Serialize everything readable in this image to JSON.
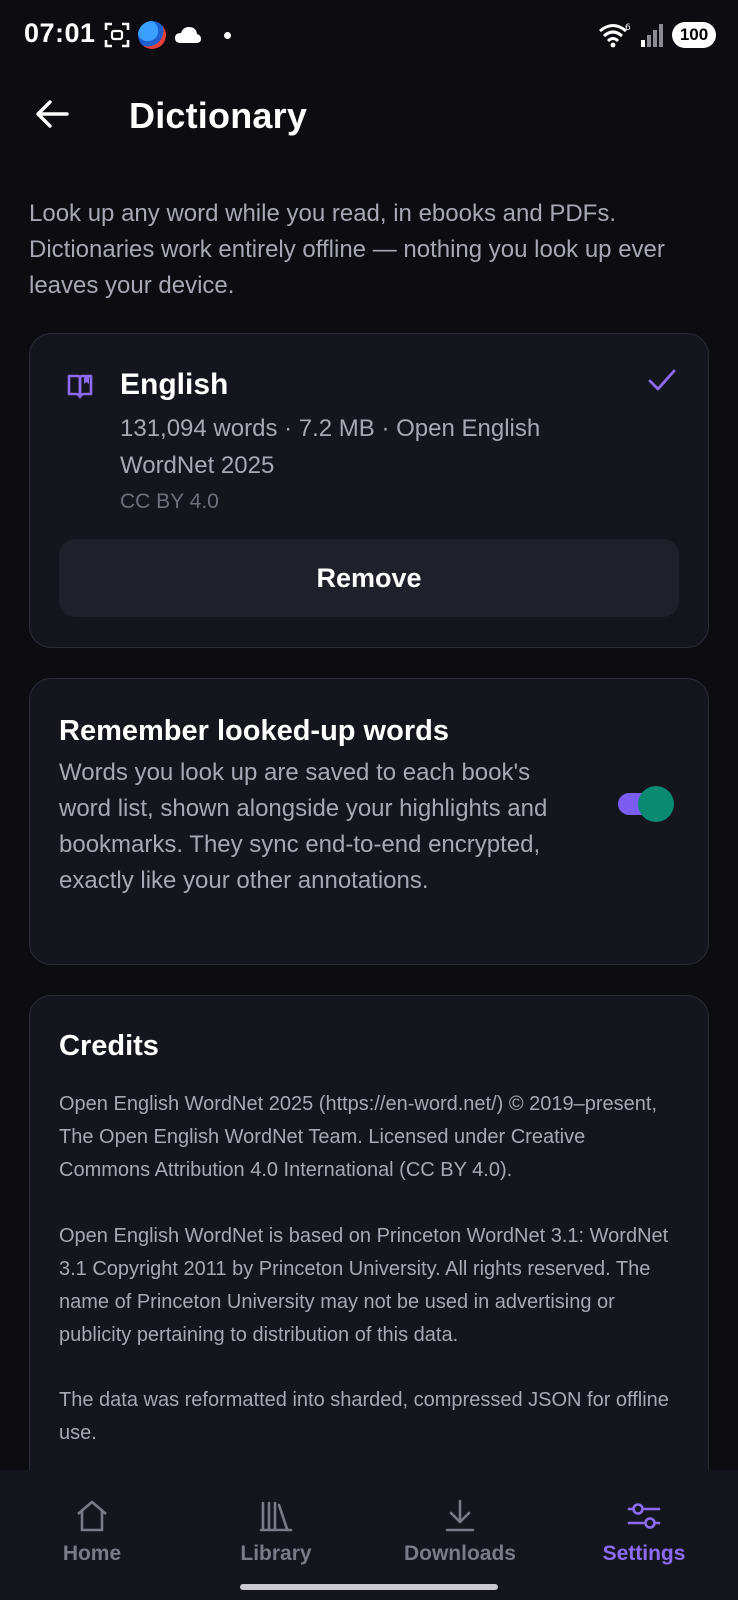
{
  "status_bar": {
    "time": "07:01",
    "battery": "100",
    "icons": [
      "screenshot-icon",
      "app-icon",
      "cloud-icon",
      "dot-icon",
      "wifi-icon",
      "signal-icon",
      "battery-icon"
    ]
  },
  "header": {
    "title": "Dictionary",
    "back_icon": "arrow-left-icon"
  },
  "intro": "Look up any word while you read, in ebooks and PDFs. Dictionaries work entirely offline — nothing you look up ever leaves your device.",
  "dictionary": {
    "name": "English",
    "meta": "131,094 words · 7.2 MB · Open English WordNet 2025",
    "license": "CC BY 4.0",
    "installed": true,
    "remove_label": "Remove"
  },
  "remember": {
    "title": "Remember looked-up words",
    "description": "Words you look up are saved to each book's word list, shown alongside your highlights and bookmarks. They sync end-to-end encrypted, exactly like your other annotations.",
    "enabled": true
  },
  "credits": {
    "title": "Credits",
    "paragraphs": [
      "Open English WordNet 2025 (https://en-word.net/) © 2019–present, The Open English WordNet Team. Licensed under Creative Commons Attribution 4.0 International (CC BY 4.0).",
      "Open English WordNet is based on Princeton WordNet 3.1: WordNet 3.1 Copyright 2011 by Princeton University. All rights reserved. The name of Princeton University may not be used in advertising or publicity pertaining to distribution of this data.",
      "The data was reformatted into sharded, compressed JSON for offline use."
    ]
  },
  "nav": {
    "items": [
      {
        "label": "Home",
        "icon": "home-icon"
      },
      {
        "label": "Library",
        "icon": "library-icon"
      },
      {
        "label": "Downloads",
        "icon": "download-icon"
      },
      {
        "label": "Settings",
        "icon": "settings-sliders-icon"
      }
    ],
    "active": "Settings"
  },
  "colors": {
    "background": "#0c0c11",
    "card": "#15151d",
    "accent": "#8c6cf5",
    "toggle_thumb": "#0b8a72",
    "secondary_text": "#a8a8b4"
  }
}
